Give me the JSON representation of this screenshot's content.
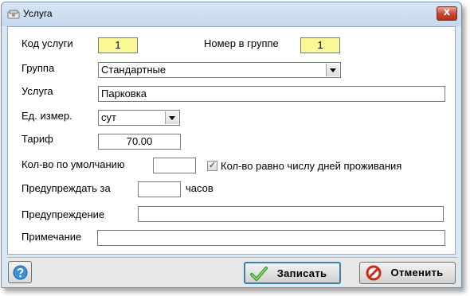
{
  "window": {
    "title": "Услуга",
    "close_symbol": "x",
    "app_icon": "service-app-icon"
  },
  "form": {
    "service_code": {
      "label": "Код услуги",
      "value": "1"
    },
    "group_number": {
      "label": "Номер в группе",
      "value": "1"
    },
    "group": {
      "label": "Группа",
      "selected": "Стандартные"
    },
    "service": {
      "label": "Услуга",
      "value": "Парковка"
    },
    "unit": {
      "label": "Ед. измер.",
      "selected": "сут"
    },
    "tariff": {
      "label": "Тариф",
      "value": "70.00"
    },
    "default_qty": {
      "label": "Кол-во по умолчанию",
      "value": ""
    },
    "qty_equals_days": {
      "label": "Кол-во равно числу дней проживания",
      "checked": true,
      "check_glyph": "✓"
    },
    "warn_before": {
      "label": "Предупреждать за",
      "value": "",
      "suffix": "часов"
    },
    "warning": {
      "label": "Предупреждение",
      "value": ""
    },
    "note": {
      "label": "Примечание",
      "value": ""
    }
  },
  "buttons": {
    "help": {
      "icon": "help-icon"
    },
    "save": {
      "label": "Записать",
      "icon": "checkmark-icon"
    },
    "cancel": {
      "label": "Отменить",
      "icon": "cancel-icon"
    }
  },
  "colors": {
    "highlight_field": "#fbf997",
    "window_frame": "#d9e7f5",
    "default_button_border": "#3c7fb1"
  }
}
